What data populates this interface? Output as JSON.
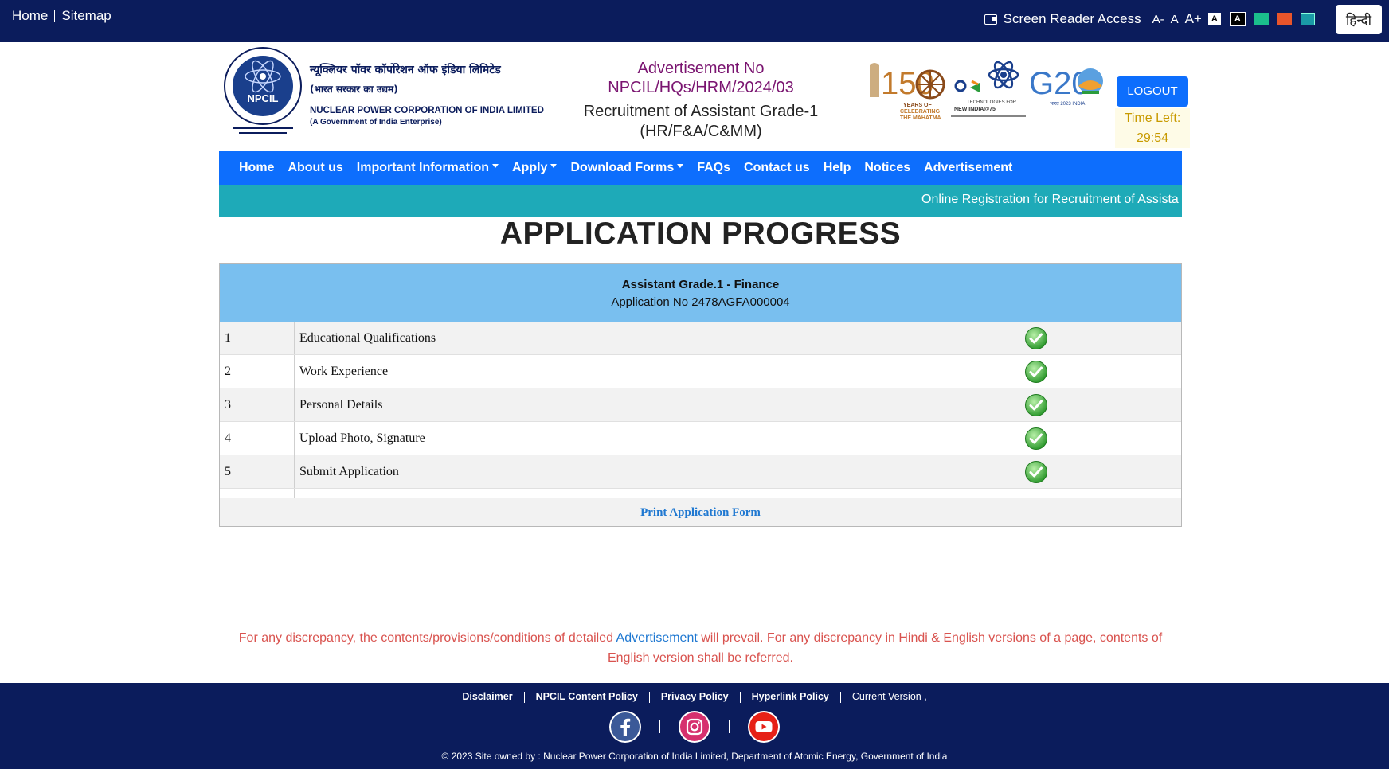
{
  "topbar": {
    "home": "Home",
    "sitemap": "Sitemap",
    "screen_reader": "Screen Reader Access",
    "font_minus": "A-",
    "font_normal": "A",
    "font_plus": "A+",
    "theme_white": "A",
    "theme_black": "A",
    "hindi": "हिन्दी"
  },
  "header": {
    "org_hindi": "न्यूक्लियर पॉवर कॉर्पोरेशन ऑफ इंडिया लिमिटेड",
    "org_hindi_sub": "(भारत सरकार का उद्यम)",
    "org_english": "NUCLEAR POWER CORPORATION OF INDIA LIMITED",
    "org_english_sub": "(A Government of India Enterprise)",
    "emblem_text": "NPCIL",
    "adv_label": "Advertisement No",
    "adv_number": "NPCIL/HQs/HRM/2024/03",
    "recruitment_line1": "Recruitment of Assistant Grade-1",
    "recruitment_line2": "(HR/F&A/C&MM)",
    "logout": "LOGOUT",
    "time_left_label": "Time Left:",
    "time_left_value": "29:54",
    "logo_150": "150",
    "logo_150_sub": "YEARS OF CELEBRATING THE MAHATMA",
    "logo_newindia": "NEW INDIA@75",
    "logo_g20": "G20"
  },
  "nav": {
    "items": [
      {
        "label": "Home",
        "dropdown": false
      },
      {
        "label": "About us",
        "dropdown": false
      },
      {
        "label": "Important Information",
        "dropdown": true
      },
      {
        "label": "Apply",
        "dropdown": true
      },
      {
        "label": "Download Forms",
        "dropdown": true
      },
      {
        "label": "FAQs",
        "dropdown": false
      },
      {
        "label": "Contact us",
        "dropdown": false
      },
      {
        "label": "Help",
        "dropdown": false
      },
      {
        "label": "Notices",
        "dropdown": false
      },
      {
        "label": "Advertisement",
        "dropdown": false
      }
    ],
    "ticker": "Online Registration for Recruitment of Assista"
  },
  "main": {
    "title": "APPLICATION PROGRESS",
    "post": "Assistant Grade.1 - Finance",
    "application_no": "Application No 2478AGFA000004",
    "steps": [
      {
        "no": "1",
        "label": "Educational Qualifications",
        "status": "complete"
      },
      {
        "no": "2",
        "label": "Work Experience",
        "status": "complete"
      },
      {
        "no": "3",
        "label": "Personal Details",
        "status": "complete"
      },
      {
        "no": "4",
        "label": "Upload Photo, Signature",
        "status": "complete"
      },
      {
        "no": "5",
        "label": "Submit Application",
        "status": "complete"
      }
    ],
    "print_link": "Print Application Form"
  },
  "notice": {
    "part1": "For any discrepancy, the contents/provisions/conditions of detailed ",
    "link": "Advertisement",
    "part2": " will prevail. For any discrepancy in Hindi & English versions of a page, contents of English version shall be referred."
  },
  "footer": {
    "links": [
      "Disclaimer",
      "NPCIL Content Policy",
      "Privacy Policy",
      "Hyperlink Policy"
    ],
    "current_version": "Current Version ,",
    "copyright": "© 2023 Site owned by : Nuclear Power Corporation of India Limited, Department of Atomic Energy, Government of India"
  },
  "colors": {
    "topbar": "#0b1c5c",
    "nav": "#0d6efd",
    "ticker": "#1eaab8",
    "panel_head": "#79bfef",
    "notice": "#d9534f"
  }
}
